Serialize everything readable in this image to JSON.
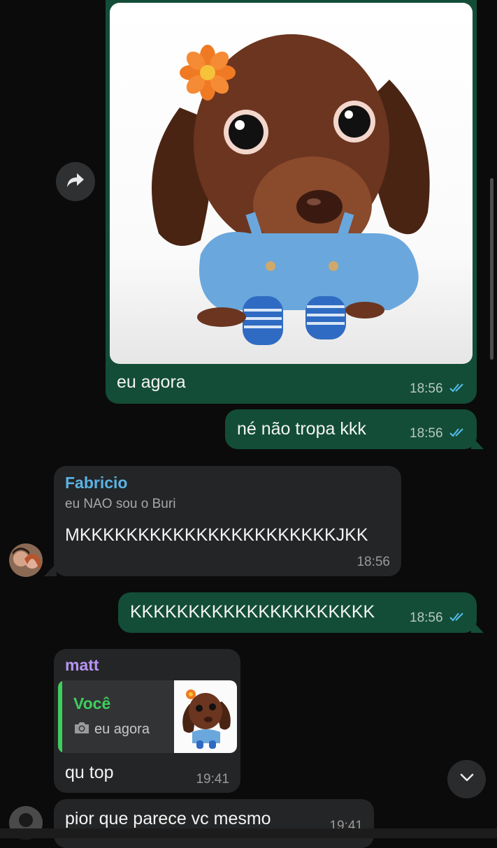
{
  "messages": {
    "m1": {
      "caption": "eu agora",
      "time": "18:56"
    },
    "m2": {
      "text": "né não tropa kkk",
      "time": "18:56"
    },
    "m3": {
      "sender": "Fabricio",
      "sender_subtitle": "eu NAO sou o Buri",
      "text": "MKKKKKKKKKKKKKKKKKKKKKKJKK",
      "time": "18:56"
    },
    "m4": {
      "text": "KKKKKKKKKKKKKKKKKKKKK",
      "time": "18:56"
    },
    "m5": {
      "sender": "matt",
      "reply": {
        "author": "Você",
        "text": "eu agora"
      },
      "text": "qu top",
      "time": "19:41"
    },
    "m6": {
      "text": "pior que parece vc mesmo",
      "time": "19:41"
    }
  },
  "colors": {
    "outgoing_bubble": "#134d37",
    "incoming_bubble": "#242526",
    "fabricio_name": "#5ab3e6",
    "matt_name": "#b794f4",
    "reply_author": "#3ecf5d",
    "read_ticks": "#53bdeb"
  },
  "icons": {
    "forward": "forward-arrow-icon",
    "scroll_down": "chevron-down-icon",
    "read_receipt": "double-check-icon",
    "camera": "camera-icon"
  }
}
